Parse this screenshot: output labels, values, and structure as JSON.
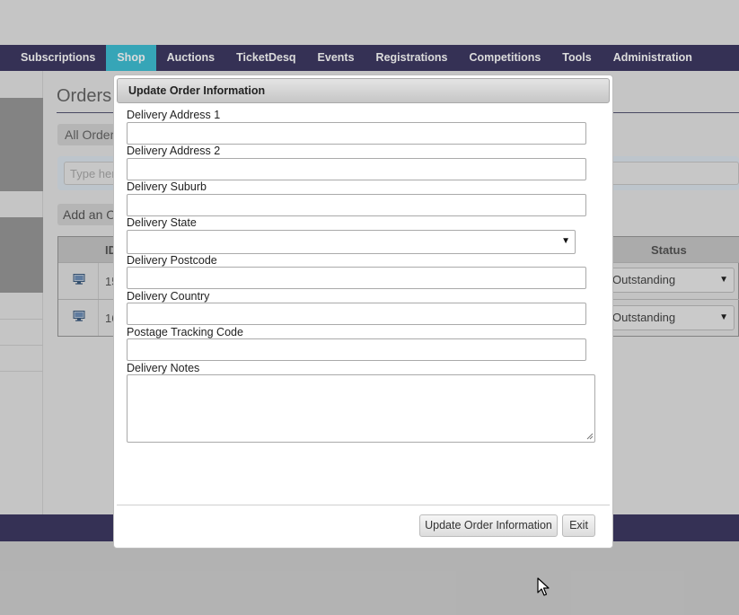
{
  "nav": {
    "items": [
      {
        "label": "Subscriptions",
        "active": false
      },
      {
        "label": "Shop",
        "active": true
      },
      {
        "label": "Auctions",
        "active": false
      },
      {
        "label": "TicketDesq",
        "active": false
      },
      {
        "label": "Events",
        "active": false
      },
      {
        "label": "Registrations",
        "active": false
      },
      {
        "label": "Competitions",
        "active": false
      },
      {
        "label": "Tools",
        "active": false
      },
      {
        "label": "Administration",
        "active": false
      }
    ]
  },
  "page": {
    "title": "Orders",
    "filter_label": "All Orders",
    "search_placeholder": "Type here",
    "add_label": "Add an Order"
  },
  "table": {
    "columns": {
      "id": "ID",
      "status": "Status"
    },
    "rows": [
      {
        "id": "15",
        "status": "Outstanding"
      },
      {
        "id": "16",
        "status": "Outstanding"
      }
    ]
  },
  "modal": {
    "title": "Update Order Information",
    "fields": {
      "address1": {
        "label": "Delivery Address 1",
        "value": ""
      },
      "address2": {
        "label": "Delivery Address 2",
        "value": ""
      },
      "suburb": {
        "label": "Delivery Suburb",
        "value": ""
      },
      "state": {
        "label": "Delivery State",
        "value": ""
      },
      "postcode": {
        "label": "Delivery Postcode",
        "value": ""
      },
      "country": {
        "label": "Delivery Country",
        "value": ""
      },
      "tracking": {
        "label": "Postage Tracking Code",
        "value": ""
      },
      "notes": {
        "label": "Delivery Notes",
        "value": ""
      }
    },
    "update_button": "Update Order Information",
    "exit_button": "Exit"
  },
  "icons": {
    "row_icon": "monitor-icon",
    "dropdown": "caret-down-icon",
    "cursor": "mouse-pointer-icon"
  },
  "colors": {
    "nav_bg": "#3e3a63",
    "nav_active": "#3fc0d6",
    "footer_bg": "#3e3a63"
  }
}
